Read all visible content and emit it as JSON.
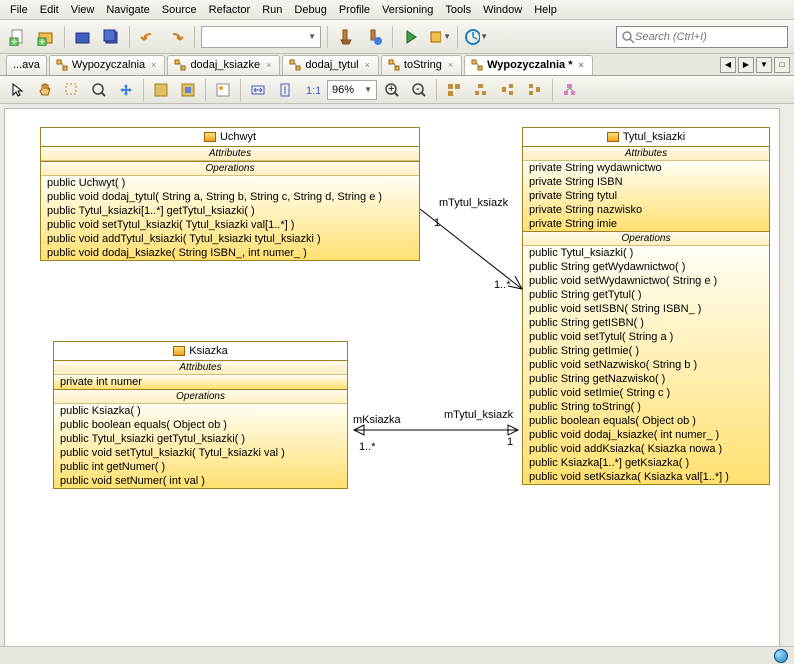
{
  "menu": [
    "File",
    "Edit",
    "View",
    "Navigate",
    "Source",
    "Refactor",
    "Run",
    "Debug",
    "Profile",
    "Versioning",
    "Tools",
    "Window",
    "Help"
  ],
  "search": {
    "placeholder": "Search (Ctrl+I)"
  },
  "tabs": [
    {
      "label": "...ava",
      "active": false
    },
    {
      "label": "Wypozyczalnia",
      "active": false
    },
    {
      "label": "dodaj_ksiazke",
      "active": false
    },
    {
      "label": "dodaj_tytul",
      "active": false
    },
    {
      "label": "toString",
      "active": false
    },
    {
      "label": "Wypozyczalnia *",
      "active": true
    }
  ],
  "zoom": "96%",
  "classes": {
    "uchwyt": {
      "name": "Uchwyt",
      "attributes": [],
      "operations": [
        "public Uchwyt( )",
        "public void  dodaj_tytul( String a, String b, String c, String d, String e )",
        "public Tytul_ksiazki[1..*]  getTytul_ksiazki( )",
        "public void  setTytul_ksiazki( Tytul_ksiazki val[1..*] )",
        "public void  addTytul_ksiazki( Tytul_ksiazki tytul_ksiazki )",
        "public void  dodaj_ksiazke( String ISBN_, int numer_ )"
      ]
    },
    "ksiazka": {
      "name": "Ksiazka",
      "attributes": [
        "private int numer"
      ],
      "operations": [
        "public Ksiazka( )",
        "public boolean  equals( Object ob )",
        "public Tytul_ksiazki  getTytul_ksiazki( )",
        "public void  setTytul_ksiazki( Tytul_ksiazki val )",
        "public int  getNumer( )",
        "public void  setNumer( int val )"
      ]
    },
    "tytul": {
      "name": "Tytul_ksiazki",
      "attributes": [
        "private String wydawnictwo",
        "private String ISBN",
        "private String tytul",
        "private String nazwisko",
        "private String imie"
      ],
      "operations": [
        "public Tytul_ksiazki( )",
        "public String  getWydawnictwo( )",
        "public void  setWydawnictwo( String e )",
        "public String  getTytul( )",
        "public void  setISBN( String ISBN_ )",
        "public String  getISBN( )",
        "public void  setTytul( String a )",
        "public String  getImie( )",
        "public void  setNazwisko( String b )",
        "public String  getNazwisko( )",
        "public void  setImie( String c )",
        "public String  toString( )",
        "public boolean  equals( Object ob )",
        "public void  dodaj_ksiazke( int numer_ )",
        "public void  addKsiazka( Ksiazka nowa )",
        "public Ksiazka[1..*]  getKsiazka( )",
        "public void  setKsiazka( Ksiazka val[1..*] )"
      ]
    }
  },
  "assoc": {
    "a1_role": "mTytul_ksiazk",
    "a1_m1": "1",
    "a1_m2": "1..*",
    "a2_role": "mKsiazka",
    "a2_m1": "1..*",
    "a3_role": "mTytul_ksiazk",
    "a3_m2": "1"
  }
}
